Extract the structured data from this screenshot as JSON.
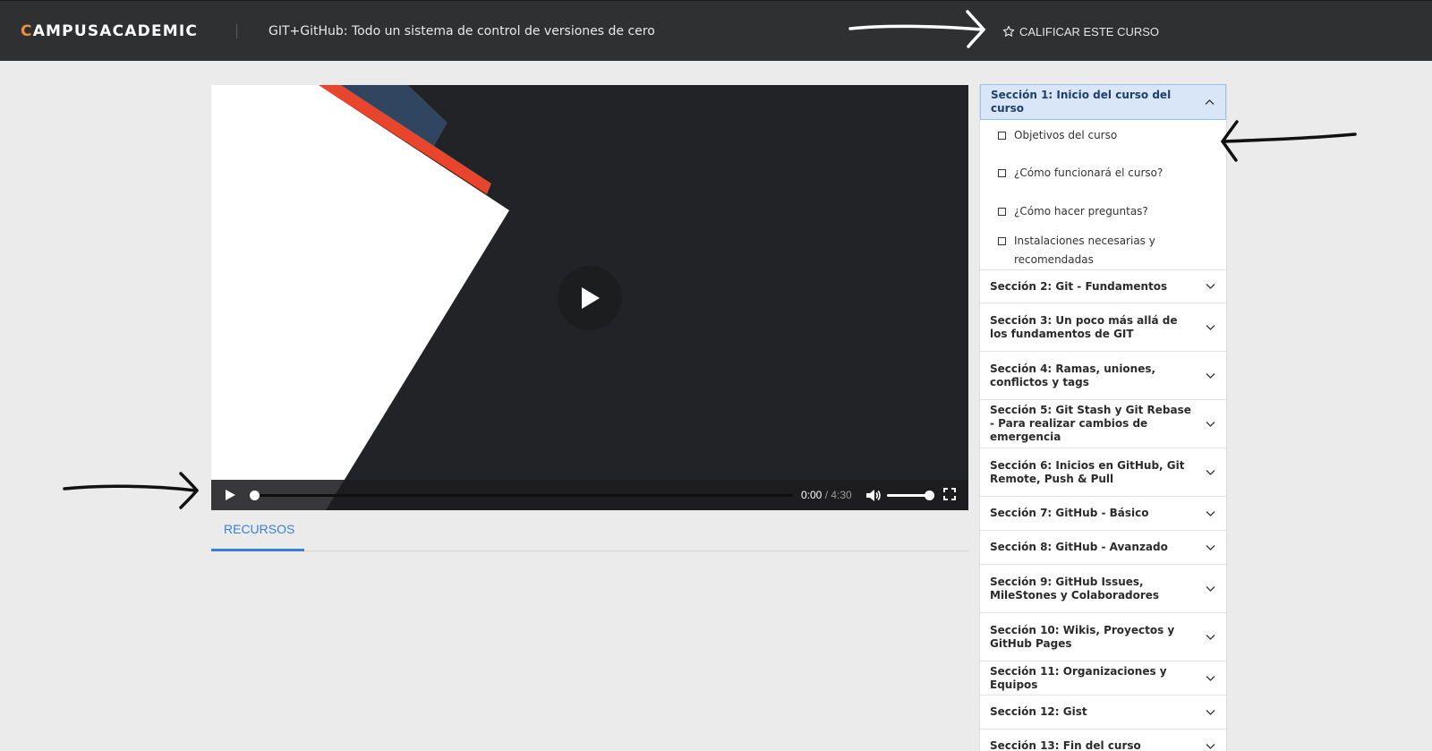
{
  "header": {
    "brand_first_letter": "C",
    "brand_rest": "AMPUSACADEMIC",
    "course_title": "GIT+GitHub: Todo un sistema de control de versiones de cero",
    "rate_label": "CALIFICAR ESTE CURSO",
    "rate_icon": "star-outline-icon"
  },
  "player": {
    "current_time": "0:00",
    "separator": " / ",
    "duration": "4:30",
    "progress": 0,
    "volume": 1.0
  },
  "tabs": [
    {
      "label": "RECURSOS",
      "active": true
    }
  ],
  "curriculum": {
    "sections": [
      {
        "title": "Sección 1: Inicio del curso del curso",
        "expanded": true,
        "lessons": [
          "Objetivos del curso",
          "¿Cómo funcionará el curso?",
          "¿Cómo hacer preguntas?",
          "Instalaciones necesarias y recomendadas"
        ]
      },
      {
        "title": "Sección 2: Git - Fundamentos"
      },
      {
        "title": "Sección 3: Un poco más allá de los fundamentos de GIT"
      },
      {
        "title": "Sección 4: Ramas, uniones, conflictos y tags"
      },
      {
        "title": "Sección 5: Git Stash y Git Rebase - Para realizar cambios de emergencia"
      },
      {
        "title": "Sección 6: Inicios en GitHub, Git Remote, Push & Pull"
      },
      {
        "title": "Sección 7: GitHub - Básico"
      },
      {
        "title": "Sección 8: GitHub - Avanzado"
      },
      {
        "title": "Sección 9: GitHub Issues, MileStones y Colaboradores"
      },
      {
        "title": "Sección 10: Wikis, Proyectos y GitHub Pages"
      },
      {
        "title": "Sección 11: Organizaciones y Equipos"
      },
      {
        "title": "Sección 12: Gist"
      },
      {
        "title": "Sección 13: Fin del curso"
      }
    ]
  },
  "colors": {
    "topbar": "#2f3032",
    "brand_accent": "#f0903c",
    "link_blue": "#3a7fd5",
    "active_section_bg": "#d8e6f8"
  }
}
